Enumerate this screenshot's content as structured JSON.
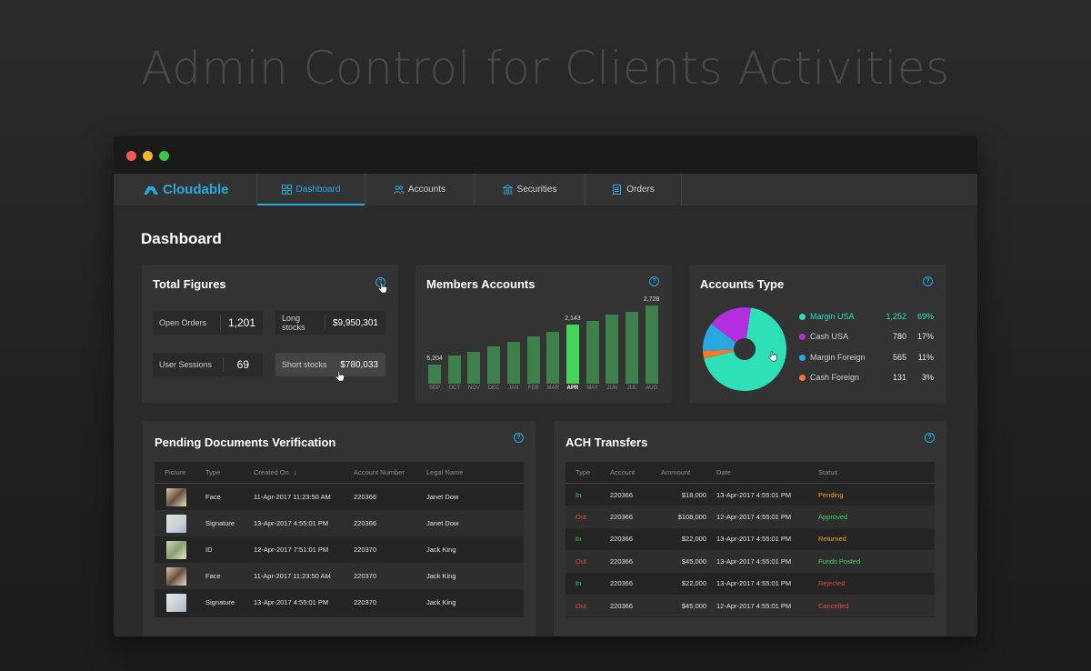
{
  "hero_title": "Admin Control for Clients Activities",
  "app": {
    "logo_text": "Cloudable"
  },
  "nav": {
    "tabs": [
      {
        "label": "Dashboard",
        "icon": "dashboard-grid-icon",
        "active": true
      },
      {
        "label": "Accounts",
        "icon": "users-icon",
        "active": false
      },
      {
        "label": "Securities",
        "icon": "bank-icon",
        "active": false
      },
      {
        "label": "Orders",
        "icon": "document-icon",
        "active": false
      }
    ]
  },
  "page_title": "Dashboard",
  "total_figures": {
    "title": "Total Figures",
    "stats": [
      {
        "label": "Open Orders",
        "value": "1,201"
      },
      {
        "label": "Long stocks",
        "value": "$9,950,301"
      },
      {
        "label": "User Sessions",
        "value": "69"
      },
      {
        "label": "Short stocks",
        "value": "$780,033"
      }
    ]
  },
  "members_accounts": {
    "title": "Members Accounts"
  },
  "chart_data": {
    "type": "bar",
    "categories": [
      "SEP",
      "OCT",
      "NOV",
      "DEC",
      "JAN",
      "FEB",
      "MAR",
      "APR",
      "MAY",
      "JUN",
      "JUL",
      "AUG"
    ],
    "values": [
      5204,
      7800,
      8900,
      10400,
      11600,
      13200,
      14500,
      16400,
      17500,
      19200,
      19900,
      21700
    ],
    "labeled": {
      "SEP": "5,204",
      "APR": "2,143",
      "AUG": "2,728"
    },
    "highlight": "APR",
    "colors": {
      "bar": "#3f7f4c",
      "highlight": "#45d45a"
    }
  },
  "accounts_type": {
    "title": "Accounts Type",
    "items": [
      {
        "name": "Margin USA",
        "count": "1,252",
        "pct": "69%",
        "color": "#2de0b8",
        "share": 69
      },
      {
        "name": "Cash USA",
        "count": "780",
        "pct": "17%",
        "color": "#b42ee0",
        "share": 17
      },
      {
        "name": "Margin Foreign",
        "count": "565",
        "pct": "11%",
        "color": "#29a8e0",
        "share": 11
      },
      {
        "name": "Cash Foreign",
        "count": "131",
        "pct": "3%",
        "color": "#f07a2a",
        "share": 3
      }
    ]
  },
  "pending_docs": {
    "title": "Pending Documents Verification",
    "columns": [
      "Picture",
      "Type",
      "Created On",
      "Account Number",
      "Legal Name"
    ],
    "sort_icon": "arrow-down-icon",
    "rows": [
      {
        "picture": "face-photo",
        "type": "Face",
        "created": "11-Apr-2017 11:23:50 AM",
        "account": "220366",
        "name": "Janet Dow"
      },
      {
        "picture": "signature-scan",
        "type": "Signature",
        "created": "13-Apr-2017 4:55:01 PM",
        "account": "220366",
        "name": "Janet Dow"
      },
      {
        "picture": "id-card",
        "type": "ID",
        "created": "12-Apr-2017 7:51:01 PM",
        "account": "220370",
        "name": "Jack King"
      },
      {
        "picture": "face-photo",
        "type": "Face",
        "created": "11-Apr-2017 11:23:50 AM",
        "account": "220370",
        "name": "Jack King"
      },
      {
        "picture": "signature-scan",
        "type": "Signature",
        "created": "13-Apr-2017 4:55:01 PM",
        "account": "220370",
        "name": "Jack King"
      }
    ]
  },
  "ach_transfers": {
    "title": "ACH Transfers",
    "columns": [
      "Type",
      "Account",
      "Ammount",
      "Date",
      "Status"
    ],
    "rows": [
      {
        "type": "In",
        "account": "220366",
        "amount": "$18,000",
        "date": "13-Apr-2017 4:55:01 PM",
        "status": "Pending",
        "type_color": "#45d45a",
        "status_color": "#f0a02a"
      },
      {
        "type": "Out",
        "account": "220366",
        "amount": "$108,000",
        "date": "12-Apr-2017 4:55:01 PM",
        "status": "Approved",
        "type_color": "#e04a3a",
        "status_color": "#45d45a"
      },
      {
        "type": "In",
        "account": "220366",
        "amount": "$22,000",
        "date": "13-Apr-2017 4:55:01 PM",
        "status": "Returned",
        "type_color": "#45d45a",
        "status_color": "#f0a02a"
      },
      {
        "type": "Out",
        "account": "220366",
        "amount": "$45,000",
        "date": "13-Apr-2017 4:55:01 PM",
        "status": "Funds Posted",
        "type_color": "#e04a3a",
        "status_color": "#45d45a"
      },
      {
        "type": "In",
        "account": "220366",
        "amount": "$22,000",
        "date": "13-Apr-2017 4:55:01 PM",
        "status": "Rejected",
        "type_color": "#45d45a",
        "status_color": "#e04a3a"
      },
      {
        "type": "Out",
        "account": "220366",
        "amount": "$45,000",
        "date": "12-Apr-2017 4:55:01 PM",
        "status": "Cancelled",
        "type_color": "#e04a3a",
        "status_color": "#e04a3a"
      }
    ]
  }
}
